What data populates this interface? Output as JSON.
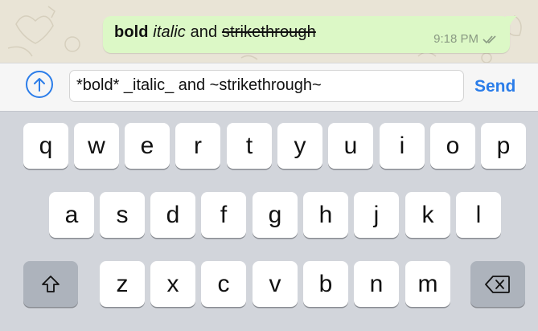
{
  "message": {
    "bold": "bold",
    "italic": "italic",
    "plain": "and",
    "strike": "strikethrough",
    "time": "9:18 PM",
    "status_icon": "double-check-icon"
  },
  "composer": {
    "attach_icon": "upload-arrow-icon",
    "text": "*bold* _italic_ and ~strikethrough~",
    "send_label": "Send"
  },
  "keyboard": {
    "row1": [
      "q",
      "w",
      "e",
      "r",
      "t",
      "y",
      "u",
      "i",
      "o",
      "p"
    ],
    "row2": [
      "a",
      "s",
      "d",
      "f",
      "g",
      "h",
      "j",
      "k",
      "l"
    ],
    "row3": [
      "z",
      "x",
      "c",
      "v",
      "b",
      "n",
      "m"
    ],
    "shift_icon": "shift-icon",
    "delete_icon": "backspace-icon"
  },
  "colors": {
    "accent": "#2b7de9",
    "bubble": "#dcf8c6",
    "keyboard_bg": "#d2d5db",
    "special_key": "#adb3bc"
  }
}
